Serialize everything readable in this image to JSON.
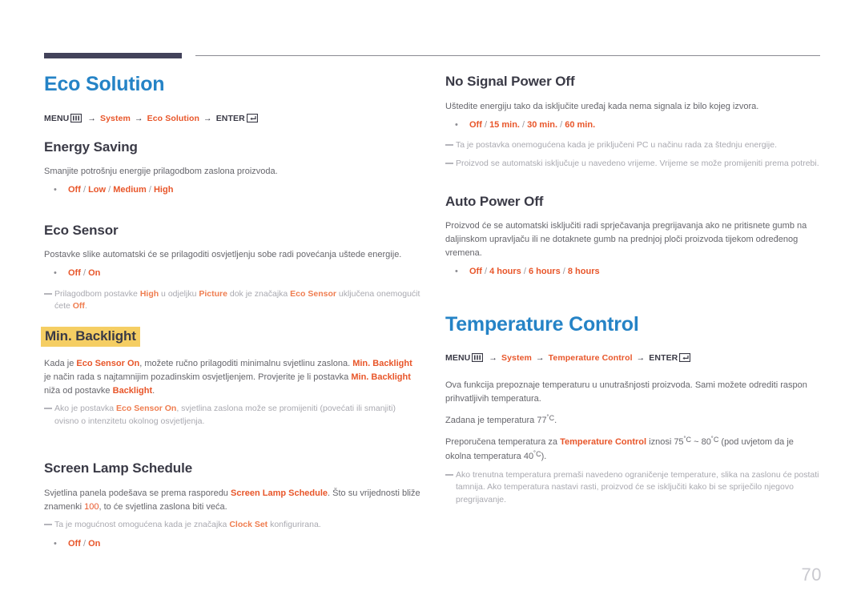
{
  "header": {
    "rule_color_thick": "#42425a",
    "rule_color_thin": "#8a8a92"
  },
  "colors": {
    "title_blue": "#2583c6",
    "accent_orange": "#e8562a",
    "highlight_yellow": "#f5ce63",
    "body_gray": "#66666c",
    "note_gray": "#a9a9b0"
  },
  "page_number": "70",
  "left_column": {
    "section_title": "Eco Solution",
    "menu_path": {
      "menu_label": "MENU",
      "menu_icon": "osd-menu-icon",
      "arrow1": "→",
      "item1": "System",
      "arrow2": "→",
      "item2": "Eco Solution",
      "arrow3": "→",
      "enter_label": "ENTER",
      "enter_icon": "osd-enter-icon"
    },
    "energy_saving": {
      "title": "Energy Saving",
      "description": "Smanjite potrošnju energije prilagodbom zaslona proizvoda.",
      "bullet": "•",
      "options": "Off / Low / Medium / High",
      "options_parts": [
        "Off",
        "Low",
        "Medium",
        "High"
      ]
    },
    "eco_sensor": {
      "title": "Eco Sensor",
      "description": "Postavke slike automatski će se prilagoditi osvjetljenju sobe radi povećanja uštede energije.",
      "bullet": "•",
      "options_parts": [
        "Off",
        "On"
      ],
      "note_pre": "Prilagodbom postavke ",
      "note_b1": "High",
      "note_mid1": " u odjeljku ",
      "note_b2": "Picture",
      "note_mid2": " dok je značajka ",
      "note_b3": "Eco Sensor",
      "note_mid3": " uključena onemogućit ćete ",
      "note_b4": "Off",
      "note_end": "."
    },
    "min_backlight": {
      "title": "Min. Backlight",
      "p_pre": "Kada je ",
      "p_b1": "Eco Sensor On",
      "p_mid1": ", možete ručno prilagoditi minimalnu svjetlinu zaslona. ",
      "p_b2": "Min. Backlight",
      "p_mid2": " je način rada s najtamnijim pozadinskim osvjetljenjem. Provjerite je li postavka ",
      "p_b3": "Min. Backlight",
      "p_mid3": " niža od postavke ",
      "p_b4": "Backlight",
      "p_end": ".",
      "note_pre": "Ako je postavka ",
      "note_b1": "Eco Sensor On",
      "note_end": ", svjetlina zaslona može se promijeniti (povećati ili smanjiti) ovisno o intenzitetu okolnog osvjetljenja."
    },
    "screen_lamp_schedule": {
      "title": "Screen Lamp Schedule",
      "p_pre": "Svjetlina panela podešava se prema rasporedu ",
      "p_b1": "Screen Lamp Schedule",
      "p_mid1": ". Što su vrijednosti bliže znamenki ",
      "p_num": "100",
      "p_end": ", to će svjetlina zaslona biti veća.",
      "note_pre": "Ta je mogućnost omogućena kada je značajka ",
      "note_b1": "Clock Set",
      "note_end": " konfigurirana.",
      "bullet": "•",
      "options_parts": [
        "Off",
        "On"
      ]
    }
  },
  "right_column": {
    "no_signal_power_off": {
      "title": "No Signal Power Off",
      "description": "Uštedite energiju tako da isključite uređaj kada nema signala iz bilo kojeg izvora.",
      "bullet": "•",
      "options_parts": [
        "Off",
        "15 min.",
        "30 min.",
        "60 min."
      ],
      "note1": "Ta je postavka onemogućena kada je priključeni PC u načinu rada za štednju energije.",
      "note2": "Proizvod se automatski isključuje u navedeno vrijeme. Vrijeme se može promijeniti prema potrebi."
    },
    "auto_power_off": {
      "title": "Auto Power Off",
      "description": "Proizvod će se automatski isključiti radi sprječavanja pregrijavanja ako ne pritisnete gumb na daljinskom upravljaču ili ne dotaknete gumb na prednjoj ploči proizvoda tijekom određenog vremena.",
      "bullet": "•",
      "options_parts": [
        "Off",
        "4 hours",
        "6 hours",
        "8 hours"
      ]
    },
    "temperature_control": {
      "section_title": "Temperature Control",
      "menu_path": {
        "menu_label": "MENU",
        "menu_icon": "osd-menu-icon",
        "arrow1": "→",
        "item1": "System",
        "arrow2": "→",
        "item2": "Temperature Control",
        "arrow3": "→",
        "enter_label": "ENTER",
        "enter_icon": "osd-enter-icon"
      },
      "p1": "Ova funkcija prepoznaje temperaturu u unutrašnjosti proizvoda. Sami možete odrediti raspon prihvatljivih temperatura.",
      "p2_pre": "Zadana je temperatura 77",
      "p2_deg": "˚C",
      "p2_end": ".",
      "p3_pre": "Preporučena temperatura za ",
      "p3_b1": "Temperature Control",
      "p3_mid1": " iznosi 75",
      "p3_deg1": "˚C",
      "p3_mid2": " ~ 80",
      "p3_deg2": "˚C",
      "p3_mid3": " (pod uvjetom da je okolna temperatura 40",
      "p3_deg3": "˚C",
      "p3_end": ").",
      "note": "Ako trenutna temperatura premaši navedeno ograničenje temperature, slika na zaslonu će postati tamnija. Ako temperatura nastavi rasti, proizvod će se isključiti kako bi se spriječilo njegovo pregrijavanje."
    }
  }
}
